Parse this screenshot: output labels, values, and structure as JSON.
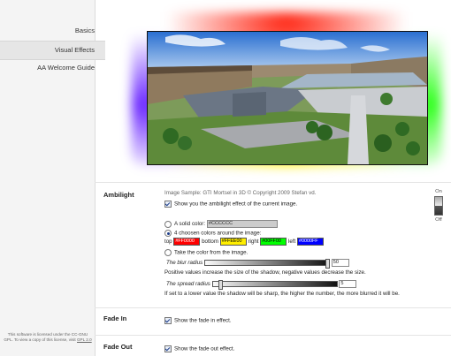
{
  "sidebar": {
    "items": [
      {
        "label": "Basics",
        "active": false
      },
      {
        "label": "Visual Effects",
        "active": true
      },
      {
        "label": "AA Welcome Guide",
        "active": false
      }
    ],
    "license": {
      "text": "This software is licensed under the CC-GNU GPL. To view a copy of this license, visit",
      "link": "GPL 2.0"
    }
  },
  "ambilight": {
    "title": "Ambilight",
    "caption": "Image Sample: GTI Mortsel in 3D © Copyright 2009 Stefan vd.",
    "show_label": "Show you the ambilight effect of the current image.",
    "solid_label": "A solid color:",
    "solid_value": "#CCCCCC",
    "four_label": "4 choosen colors around the image:",
    "top_label": "top",
    "top_value": "#FF0000",
    "bottom_label": "bottom",
    "bottom_value": "#FFEE00",
    "right_label": "right",
    "right_value": "#00FF00",
    "left_label": "left",
    "left_value": "#0000FF",
    "take_label": "Take the color from the image.",
    "blur_label": "The blur radius",
    "blur_value": "50",
    "blur_level": 1.0,
    "blur_note": "Positive values increase the size of the shadow, negative values decrease the size.",
    "spread_label": "The spread radius",
    "spread_value": "5",
    "spread_level": 0.05,
    "spread_note": "If set to a lower value the shadow will be sharp, the higher the number, the more blurred it will be.",
    "toggle_on": "On",
    "toggle_off": "Off",
    "colors": {
      "top": "#FF0000",
      "bottom": "#FFEE00",
      "right": "#00FF00",
      "left": "#0000FF",
      "solid": "#CCCCCC"
    }
  },
  "fade_in": {
    "title": "Fade In",
    "label": "Show the fade in effect."
  },
  "fade_out": {
    "title": "Fade Out",
    "label": "Show the fade out effect."
  }
}
